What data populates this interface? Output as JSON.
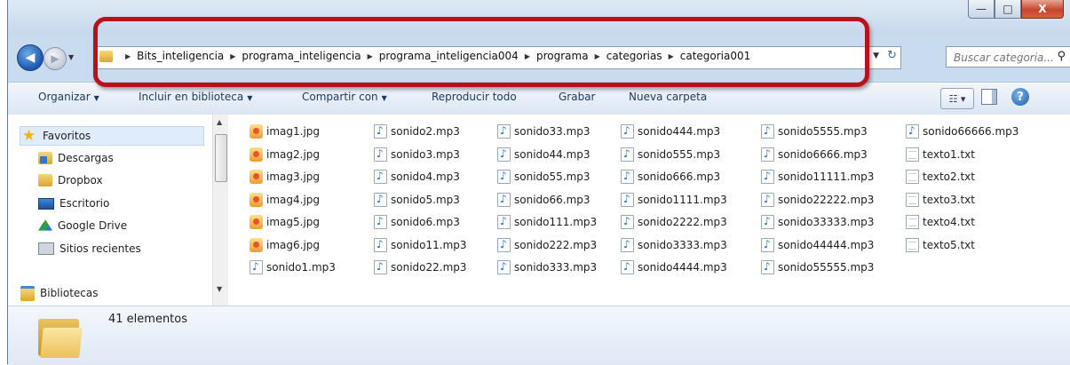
{
  "window": {
    "controls": {
      "minimize": "—",
      "maximize": "□",
      "close": "X"
    }
  },
  "address_bar": {
    "crumbs": [
      "Bits_inteligencia",
      "programa_inteligencia",
      "programa_inteligencia004",
      "programa",
      "categorias",
      "categoria001"
    ]
  },
  "search": {
    "placeholder": "Buscar categoria..."
  },
  "toolbar": {
    "organize": "Organizar",
    "include": "Incluir en biblioteca",
    "share": "Compartir con",
    "play_all": "Reproducir todo",
    "burn": "Grabar",
    "new_folder": "Nueva carpeta",
    "help": "?"
  },
  "navigation": {
    "favorites": "Favoritos",
    "items": [
      "Descargas",
      "Dropbox",
      "Escritorio",
      "Google Drive",
      "Sitios recientes"
    ],
    "libraries": "Bibliotecas"
  },
  "files": {
    "columns": [
      [
        "imag1.jpg",
        "imag2.jpg",
        "imag3.jpg",
        "imag4.jpg",
        "imag5.jpg",
        "imag6.jpg",
        "sonido1.mp3"
      ],
      [
        "sonido2.mp3",
        "sonido3.mp3",
        "sonido4.mp3",
        "sonido5.mp3",
        "sonido6.mp3",
        "sonido11.mp3",
        "sonido22.mp3"
      ],
      [
        "sonido33.mp3",
        "sonido44.mp3",
        "sonido55.mp3",
        "sonido66.mp3",
        "sonido111.mp3",
        "sonido222.mp3",
        "sonido333.mp3"
      ],
      [
        "sonido444.mp3",
        "sonido555.mp3",
        "sonido666.mp3",
        "sonido1111.mp3",
        "sonido2222.mp3",
        "sonido3333.mp3",
        "sonido4444.mp3"
      ],
      [
        "sonido5555.mp3",
        "sonido6666.mp3",
        "sonido11111.mp3",
        "sonido22222.mp3",
        "sonido33333.mp3",
        "sonido44444.mp3",
        "sonido55555.mp3"
      ],
      [
        "sonido66666.mp3",
        "texto1.txt",
        "texto2.txt",
        "texto3.txt",
        "texto4.txt",
        "texto5.txt"
      ]
    ]
  },
  "status": {
    "count": "41 elementos"
  },
  "colors": {
    "highlight_border": "#b8111a",
    "toolbar_text": "#1e395b"
  }
}
